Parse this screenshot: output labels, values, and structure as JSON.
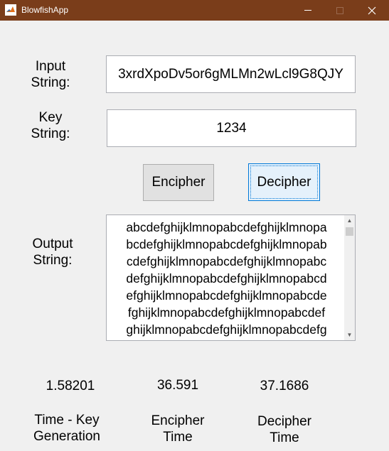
{
  "window": {
    "title": "BlowfishApp",
    "controls": {
      "minimize": "minimize",
      "maximize": "maximize",
      "close": "close"
    }
  },
  "input": {
    "label_line1": "Input",
    "label_line2": "String:",
    "value": "3xrdXpoDv5or6gMLMn2wLcl9G8QJY"
  },
  "key": {
    "label_line1": "Key",
    "label_line2": "String:",
    "value": "1234"
  },
  "buttons": {
    "encipher": "Encipher",
    "decipher": "Decipher"
  },
  "output": {
    "label_line1": "Output",
    "label_line2": "String:",
    "lines": [
      "abcdefghijklmnopabcdefghijklmnopa",
      "bcdefghijklmnopabcdefghijklmnopab",
      "cdefghijklmnopabcdefghijklmnopabc",
      "defghijklmnopabcdefghijklmnopabcd",
      "efghijklmnopabcdefghijklmnopabcde",
      "fghijklmnopabcdefghijklmnopabcdef",
      "ghijklmnopabcdefghijklmnopabcdefg"
    ]
  },
  "timings": {
    "key_generation": {
      "value": "1.58201",
      "label_line1": "Time - Key",
      "label_line2": "Generation"
    },
    "encipher": {
      "value": "36.591",
      "label_line1": "Encipher",
      "label_line2": "Time"
    },
    "decipher": {
      "value": "37.1686",
      "label_line1": "Decipher",
      "label_line2": "Time"
    }
  },
  "colors": {
    "titlebar": "#7a3d1a",
    "window_bg": "#f0f0f0",
    "focus_button_bg": "#e5f1fb",
    "focus_button_border": "#0078d7"
  }
}
